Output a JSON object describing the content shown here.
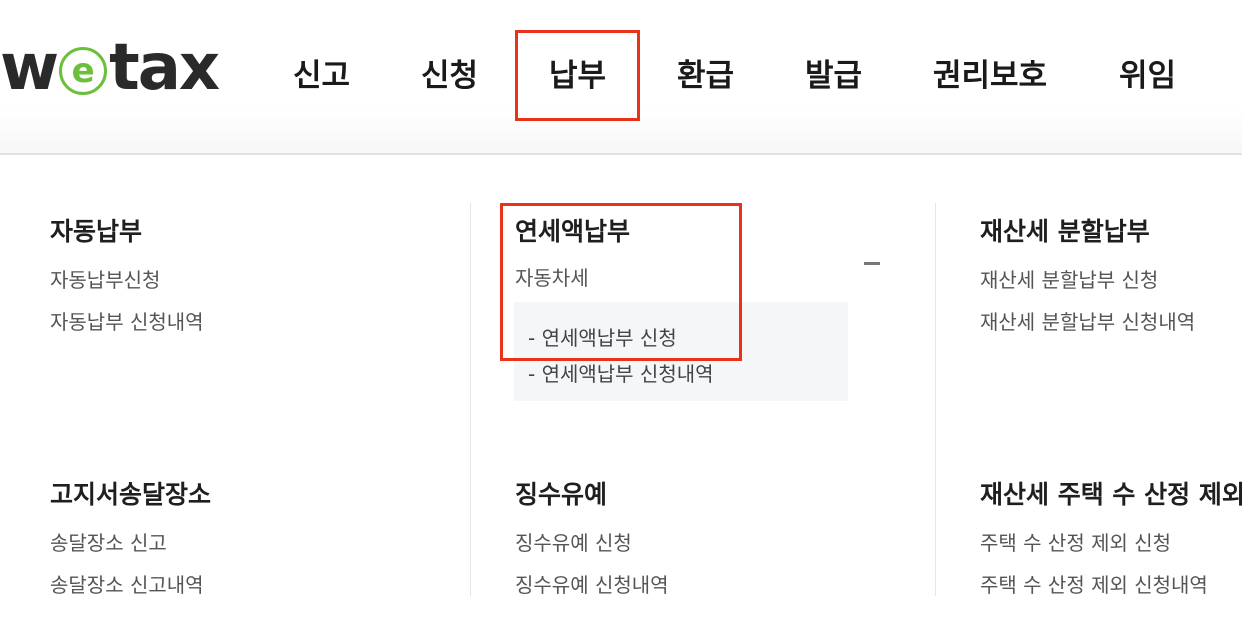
{
  "logo": {
    "before": "w",
    "e": "e",
    "after": "tax"
  },
  "nav": [
    "신고",
    "신청",
    "납부",
    "환급",
    "발급",
    "권리보호",
    "위임"
  ],
  "menu": {
    "col1": {
      "sec1": {
        "title": "자동납부",
        "links": [
          "자동납부신청",
          "자동납부 신청내역"
        ]
      },
      "sec2": {
        "title": "고지서송달장소",
        "links": [
          "송달장소 신고",
          "송달장소 신고내역"
        ]
      }
    },
    "col2": {
      "sec1": {
        "title": "연세액납부",
        "links": [
          "자동차세"
        ],
        "sublinks": [
          "- 연세액납부 신청",
          "- 연세액납부 신청내역"
        ]
      },
      "sec2": {
        "title": "징수유예",
        "links": [
          "징수유예 신청",
          "징수유예 신청내역"
        ]
      }
    },
    "col3": {
      "sec1": {
        "title": "재산세 분할납부",
        "links": [
          "재산세 분할납부 신청",
          "재산세 분할납부 신청내역"
        ]
      },
      "sec2": {
        "title": "재산세 주택 수 산정 제외",
        "links": [
          "주택 수 산정 제외 신청",
          "주택 수 산정 제외 신청내역"
        ]
      }
    }
  },
  "colors": {
    "highlight": "#e8321a",
    "logo_green": "#6cbf3a"
  }
}
